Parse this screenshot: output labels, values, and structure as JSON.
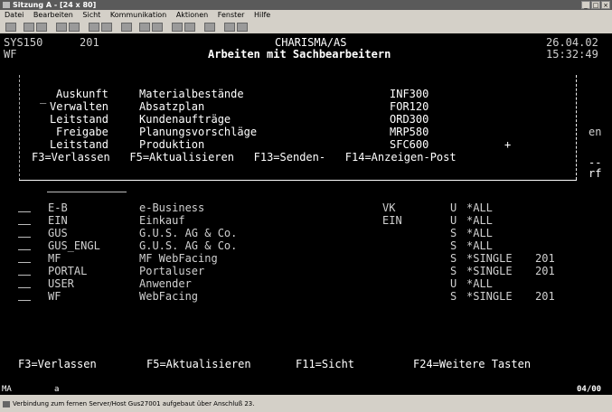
{
  "window": {
    "title": "Sitzung A - [24 x 80]",
    "controls": [
      "_",
      "□",
      "×"
    ]
  },
  "menu": [
    "Datei",
    "Bearbeiten",
    "Sicht",
    "Kommunikation",
    "Aktionen",
    "Fenster",
    "Hilfe"
  ],
  "header": {
    "system": "SYS150",
    "sysnum": "201",
    "app": "CHARISMA/AS",
    "date": "26.04.02",
    "user": "WF",
    "title": "Arbeiten mit Sachbearbeitern",
    "time": "15:32:49"
  },
  "popup": {
    "cursor": "_",
    "rows": [
      {
        "action": "Auskunft",
        "desc": "Materialbestände",
        "code": "INF300"
      },
      {
        "action": "Verwalten",
        "desc": "Absatzplan",
        "code": "FOR120"
      },
      {
        "action": "Leitstand",
        "desc": "Kundenaufträge",
        "code": "ORD300"
      },
      {
        "action": "Freigabe",
        "desc": "Planungsvorschläge",
        "code": "MRP580"
      },
      {
        "action": "Leitstand",
        "desc": "Produktion",
        "code": "SFC600"
      }
    ],
    "more": "+",
    "keys": "F3=Verlassen   F5=Aktualisieren   F13=Senden-   F14=Anzeigen-Post"
  },
  "right_fragments": {
    "en": "en",
    "dashes": "--",
    "rf": "rf"
  },
  "list": {
    "rows": [
      {
        "id": "E-B",
        "desc": "e-Business",
        "dept": "VK",
        "flag": "U",
        "profile": "*ALL",
        "num": ""
      },
      {
        "id": "EIN",
        "desc": "Einkauf",
        "dept": "EIN",
        "flag": "U",
        "profile": "*ALL",
        "num": ""
      },
      {
        "id": "GUS",
        "desc": "G.U.S. AG & Co.",
        "dept": "",
        "flag": "S",
        "profile": "*ALL",
        "num": ""
      },
      {
        "id": "GUS_ENGL",
        "desc": "G.U.S. AG & Co.",
        "dept": "",
        "flag": "S",
        "profile": "*ALL",
        "num": ""
      },
      {
        "id": "MF",
        "desc": "MF WebFacing",
        "dept": "",
        "flag": "S",
        "profile": "*SINGLE",
        "num": "201"
      },
      {
        "id": "PORTAL",
        "desc": "Portaluser",
        "dept": "",
        "flag": "S",
        "profile": "*SINGLE",
        "num": "201"
      },
      {
        "id": "USER",
        "desc": "Anwender",
        "dept": "",
        "flag": "U",
        "profile": "*ALL",
        "num": ""
      },
      {
        "id": "WF",
        "desc": "WebFacing",
        "dept": "",
        "flag": "S",
        "profile": "*SINGLE",
        "num": "201"
      }
    ]
  },
  "fkeys": {
    "f3": "F3=Verlassen",
    "f5": "F5=Aktualisieren",
    "f11": "F11=Sicht",
    "f24": "F24=Weitere Tasten"
  },
  "oia": {
    "left": "MA",
    "mid": "a",
    "pos": "04/00"
  },
  "statusbar": {
    "text": "Verbindung zum fernen Server/Host Gus27001 aufgebaut über Anschluß 23."
  }
}
